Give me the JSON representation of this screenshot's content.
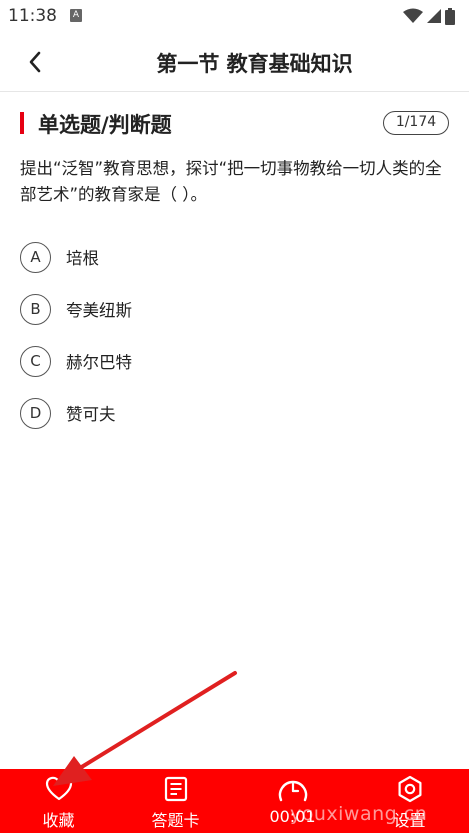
{
  "status": {
    "time": "11:38",
    "notif_letter": "A"
  },
  "header": {
    "title": "第一节 教育基础知识",
    "back_icon": "chevron-left-icon"
  },
  "section": {
    "title": "单选题/判断题",
    "counter": "1/174"
  },
  "question": {
    "text": "提出“泛智”教育思想，探讨“把一切事物教给一切人类的全部艺术”的教育家是（ ）。"
  },
  "options": [
    {
      "letter": "A",
      "text": "培根"
    },
    {
      "letter": "B",
      "text": "夸美纽斯"
    },
    {
      "letter": "C",
      "text": "赫尔巴特"
    },
    {
      "letter": "D",
      "text": "赞可夫"
    }
  ],
  "bottom_nav": {
    "favorite": {
      "label": "收藏",
      "icon": "heart-icon"
    },
    "answer_card": {
      "label": "答题卡",
      "icon": "answer-sheet-icon"
    },
    "timer": {
      "label": "00:01",
      "icon": "clock-icon"
    },
    "settings": {
      "label": "设置",
      "icon": "gear-icon"
    }
  },
  "watermark": "youxiwang.cn",
  "colors": {
    "accent": "#e60012",
    "bottom_bar": "#ff0000",
    "annotation_arrow": "#e02020"
  }
}
